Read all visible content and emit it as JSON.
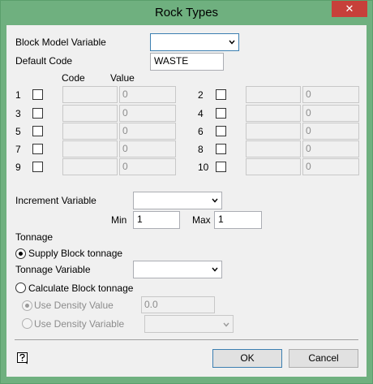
{
  "window": {
    "title": "Rock Types",
    "close_glyph": "✕"
  },
  "block_model_variable": {
    "label": "Block Model Variable",
    "value": ""
  },
  "default_code": {
    "label": "Default Code",
    "value": "WASTE"
  },
  "grid": {
    "code_header": "Code",
    "value_header": "Value",
    "rows": [
      {
        "num": "1",
        "code": "",
        "value": "0",
        "checked": false
      },
      {
        "num": "2",
        "code": "",
        "value": "0",
        "checked": false
      },
      {
        "num": "3",
        "code": "",
        "value": "0",
        "checked": false
      },
      {
        "num": "4",
        "code": "",
        "value": "0",
        "checked": false
      },
      {
        "num": "5",
        "code": "",
        "value": "0",
        "checked": false
      },
      {
        "num": "6",
        "code": "",
        "value": "0",
        "checked": false
      },
      {
        "num": "7",
        "code": "",
        "value": "0",
        "checked": false
      },
      {
        "num": "8",
        "code": "",
        "value": "0",
        "checked": false
      },
      {
        "num": "9",
        "code": "",
        "value": "0",
        "checked": false
      },
      {
        "num": "10",
        "code": "",
        "value": "0",
        "checked": false
      }
    ]
  },
  "increment": {
    "label": "Increment Variable",
    "value": "",
    "min_label": "Min",
    "min_value": "1",
    "max_label": "Max",
    "max_value": "1"
  },
  "tonnage": {
    "section_label": "Tonnage",
    "supply_label": "Supply Block tonnage",
    "supply_selected": true,
    "variable_label": "Tonnage Variable",
    "variable_value": "",
    "calculate_label": "Calculate Block tonnage",
    "calculate_selected": false,
    "density_value_label": "Use Density Value",
    "density_value": "0.0",
    "density_variable_label": "Use Density Variable",
    "density_variable_value": ""
  },
  "footer": {
    "help_icon": "help-icon",
    "ok_label": "OK",
    "cancel_label": "Cancel"
  },
  "colors": {
    "titlebar": "#6fb07f",
    "close": "#c7403a",
    "client": "#f0f0f0"
  }
}
